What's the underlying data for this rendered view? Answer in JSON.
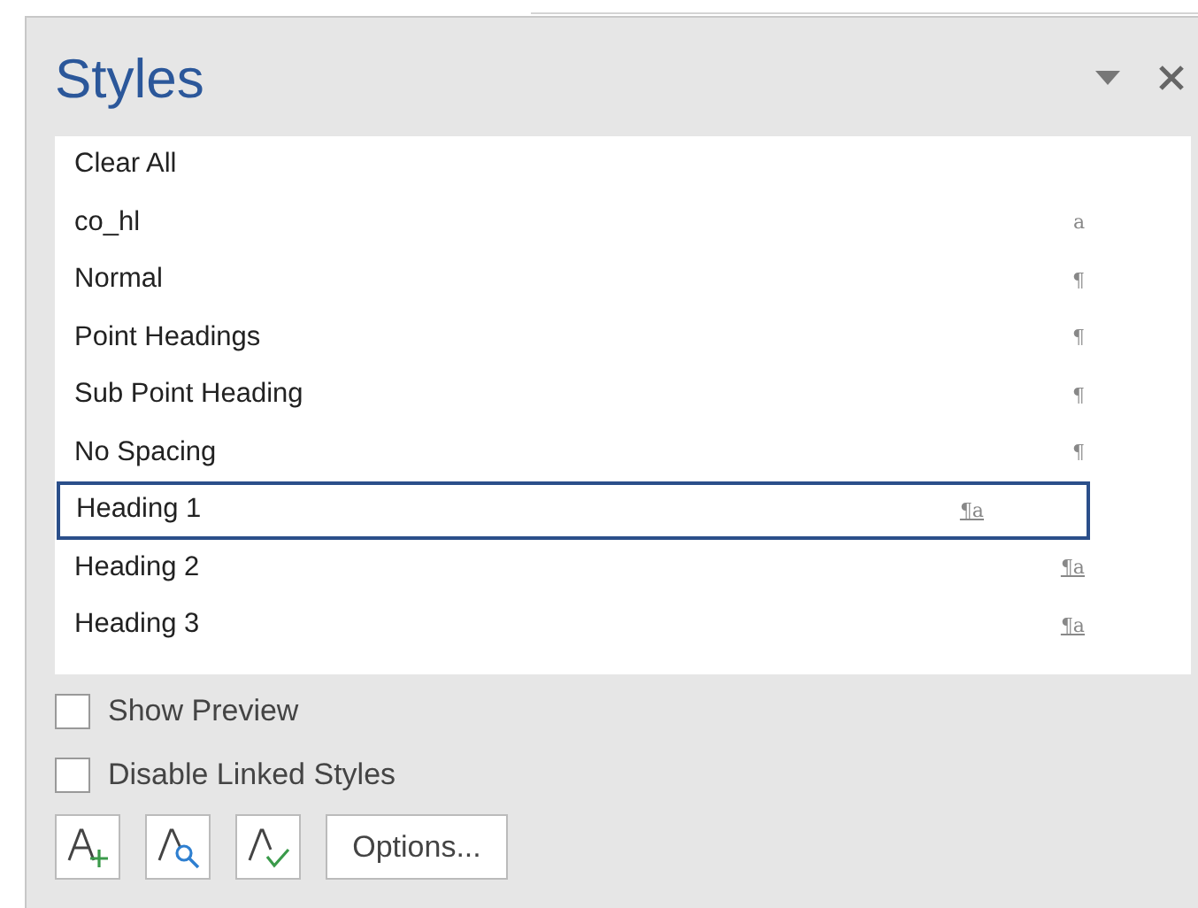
{
  "panel": {
    "title": "Styles"
  },
  "styles": [
    {
      "name": "Clear All",
      "kind": "none",
      "selected": false
    },
    {
      "name": "co_hl",
      "kind": "character",
      "mark": "a",
      "selected": false
    },
    {
      "name": "Normal",
      "kind": "paragraph",
      "mark": "¶",
      "selected": false
    },
    {
      "name": "Point Headings",
      "kind": "paragraph",
      "mark": "¶",
      "selected": false
    },
    {
      "name": "Sub Point Heading",
      "kind": "paragraph",
      "mark": "¶",
      "selected": false
    },
    {
      "name": "No Spacing",
      "kind": "paragraph",
      "mark": "¶",
      "selected": false
    },
    {
      "name": "Heading 1",
      "kind": "linked",
      "mark": "¶a",
      "selected": true
    },
    {
      "name": "Heading 2",
      "kind": "linked",
      "mark": "¶a",
      "selected": false
    },
    {
      "name": "Heading 3",
      "kind": "linked",
      "mark": "¶a",
      "selected": false
    }
  ],
  "options": [
    {
      "label": "Show Preview",
      "checked": false
    },
    {
      "label": "Disable Linked Styles",
      "checked": false
    }
  ],
  "buttons": {
    "options": "Options..."
  }
}
